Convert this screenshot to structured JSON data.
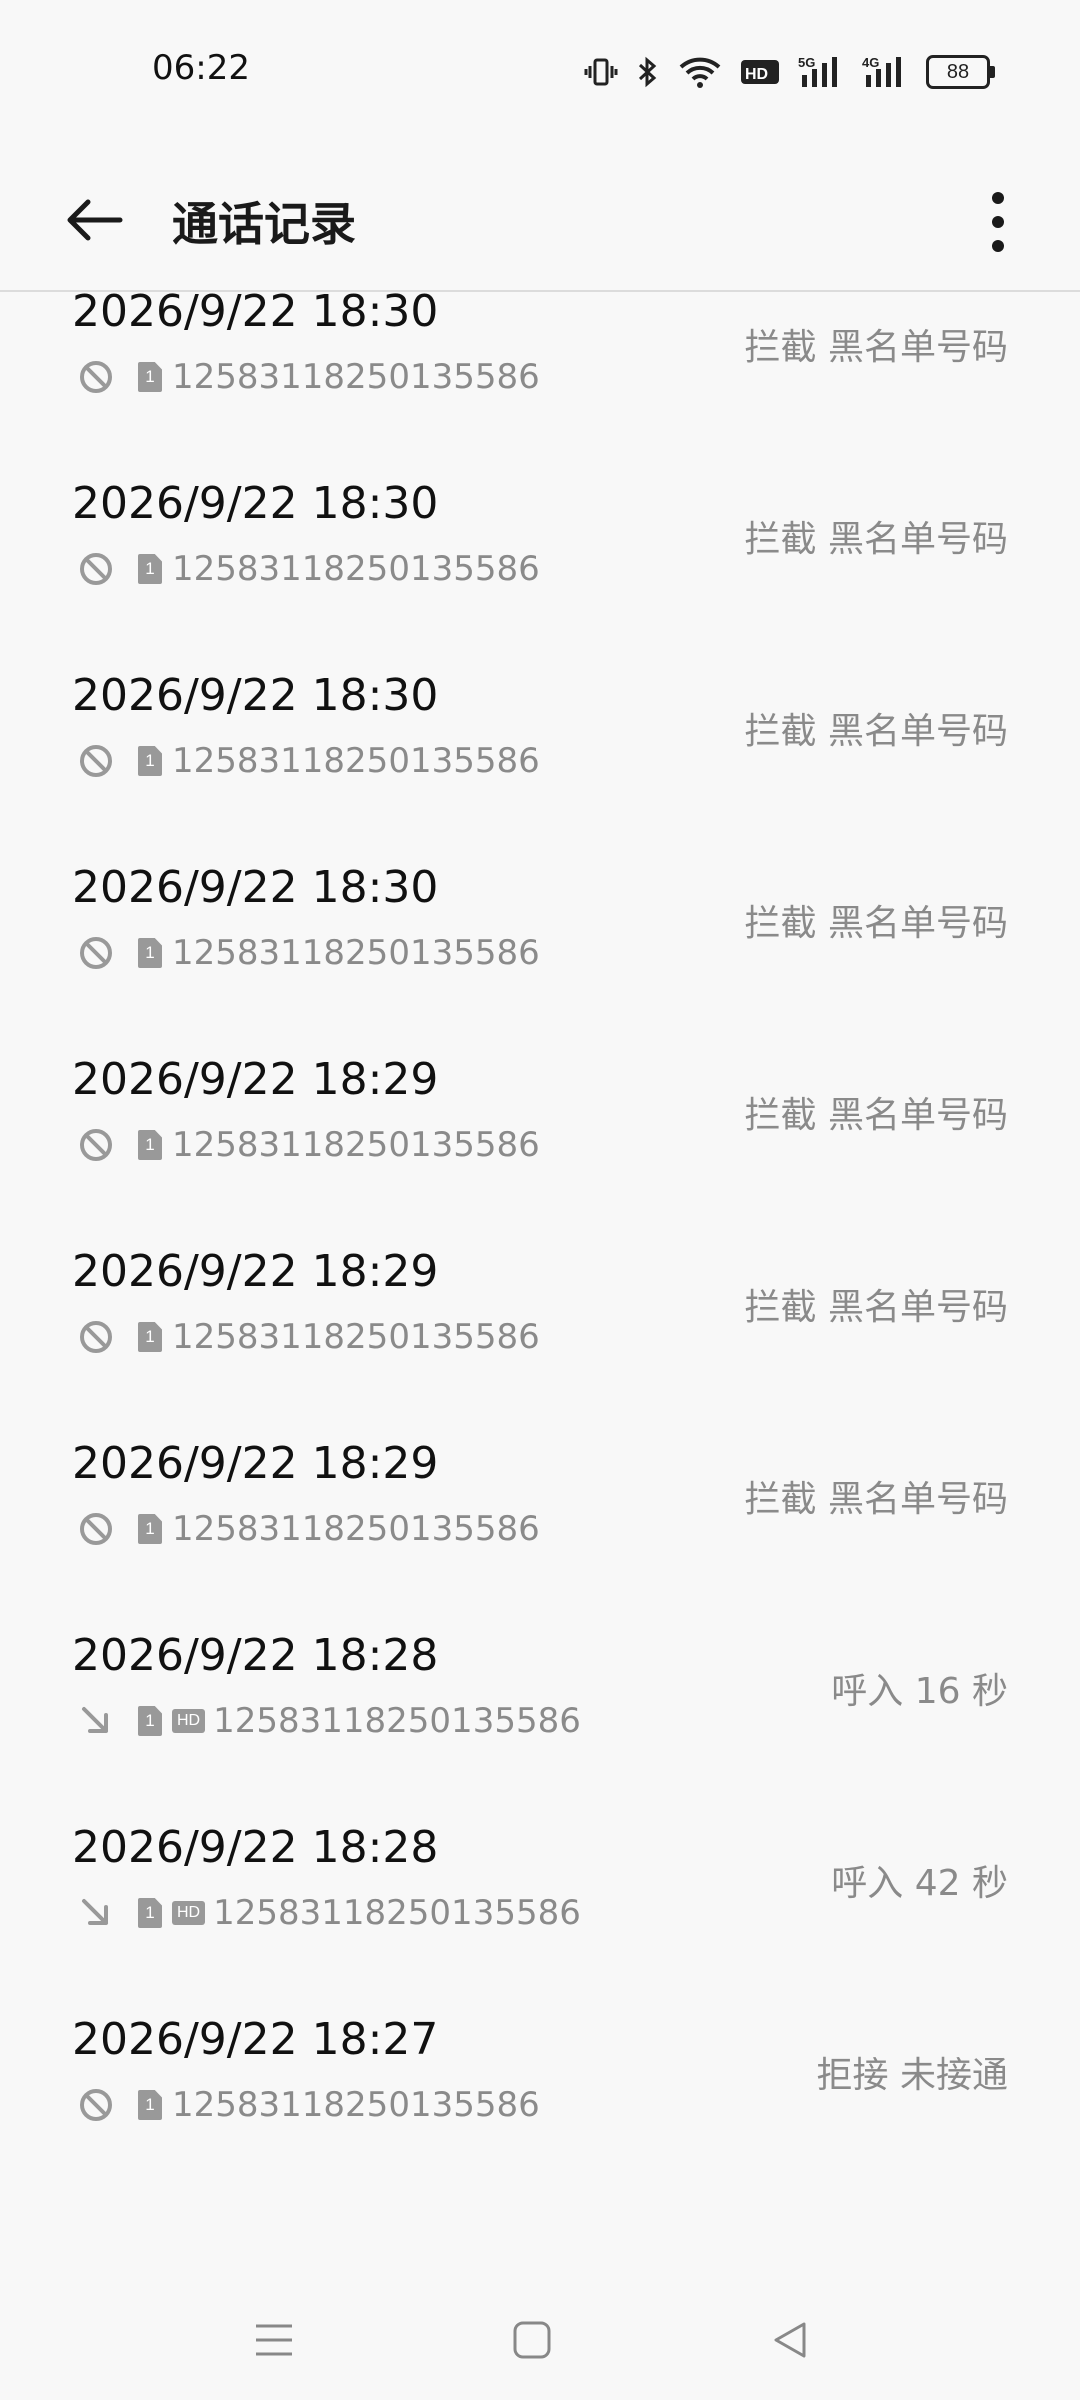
{
  "status_bar": {
    "time": "06:22",
    "battery": "88"
  },
  "header": {
    "title": "通话记录"
  },
  "calls": [
    {
      "date": "2026/9/22 18:30",
      "number": "12583118250135586",
      "status": "拦截  黑名单号码",
      "type": "blocked",
      "hd": false
    },
    {
      "date": "2026/9/22 18:30",
      "number": "12583118250135586",
      "status": "拦截  黑名单号码",
      "type": "blocked",
      "hd": false
    },
    {
      "date": "2026/9/22 18:30",
      "number": "12583118250135586",
      "status": "拦截  黑名单号码",
      "type": "blocked",
      "hd": false
    },
    {
      "date": "2026/9/22 18:30",
      "number": "12583118250135586",
      "status": "拦截  黑名单号码",
      "type": "blocked",
      "hd": false
    },
    {
      "date": "2026/9/22 18:29",
      "number": "12583118250135586",
      "status": "拦截  黑名单号码",
      "type": "blocked",
      "hd": false
    },
    {
      "date": "2026/9/22 18:29",
      "number": "12583118250135586",
      "status": "拦截  黑名单号码",
      "type": "blocked",
      "hd": false
    },
    {
      "date": "2026/9/22 18:29",
      "number": "12583118250135586",
      "status": "拦截  黑名单号码",
      "type": "blocked",
      "hd": false
    },
    {
      "date": "2026/9/22 18:28",
      "number": "12583118250135586",
      "status": "呼入  16 秒",
      "type": "incoming",
      "hd": true
    },
    {
      "date": "2026/9/22 18:28",
      "number": "12583118250135586",
      "status": "呼入  42 秒",
      "type": "incoming",
      "hd": true
    },
    {
      "date": "2026/9/22 18:27",
      "number": "12583118250135586",
      "status": "拒接 未接通",
      "type": "blocked",
      "hd": false
    }
  ],
  "sim_label": "1",
  "hd_label": "HD",
  "icons": {
    "blocked": "blocked-icon",
    "incoming": "incoming-call-icon"
  }
}
